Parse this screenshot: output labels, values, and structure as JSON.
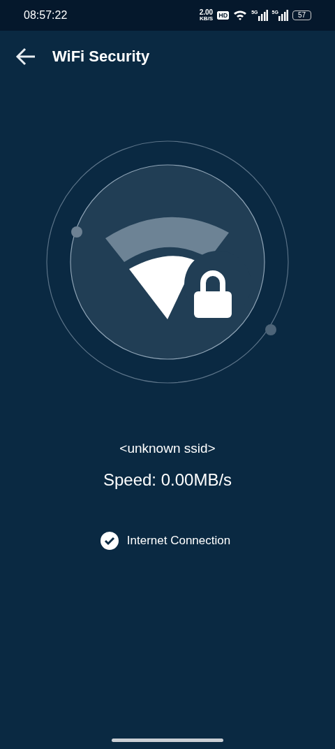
{
  "status_bar": {
    "time": "08:57:22",
    "net_speed": "2.00",
    "net_unit": "KB/S",
    "hd_label": "HD",
    "signal_labels": [
      "5G",
      "5G"
    ],
    "battery": "57"
  },
  "header": {
    "title": "WiFi Security"
  },
  "network": {
    "ssid": "<unknown ssid>",
    "speed": "Speed: 0.00MB/s"
  },
  "checks": [
    {
      "label": "Internet Connection",
      "checked": true
    }
  ]
}
